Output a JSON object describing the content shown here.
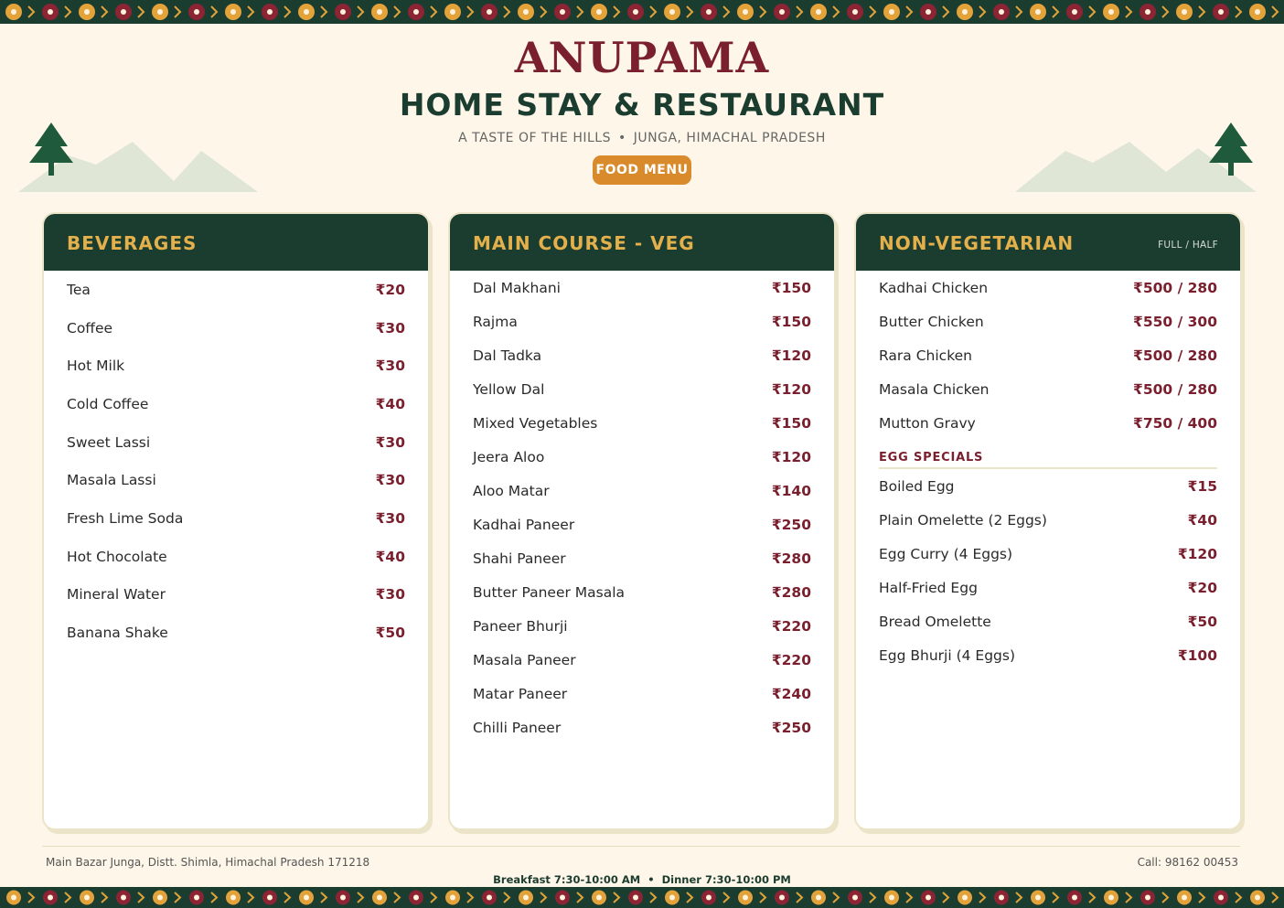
{
  "header": {
    "brand": "ANUPAMA",
    "subtitle": "HOME STAY & RESTAURANT",
    "tagline_left": "A TASTE OF THE HILLS",
    "tagline_sep": "•",
    "tagline_right": "JUNGA, HIMACHAL PRADESH",
    "badge": "FOOD MENU"
  },
  "colors": {
    "brand": "#7a1f2e",
    "green": "#1b3d2f",
    "gold": "#e3b04b",
    "orange": "#d98b2b",
    "cream": "#fdf6e9"
  },
  "beverages": {
    "title": "BEVERAGES",
    "items": [
      {
        "name": "Tea",
        "price": "₹20"
      },
      {
        "name": "Coffee",
        "price": "₹30"
      },
      {
        "name": "Hot Milk",
        "price": "₹30"
      },
      {
        "name": "Cold Coffee",
        "price": "₹40"
      },
      {
        "name": "Sweet Lassi",
        "price": "₹30"
      },
      {
        "name": "Masala Lassi",
        "price": "₹30"
      },
      {
        "name": "Fresh Lime Soda",
        "price": "₹30"
      },
      {
        "name": "Hot Chocolate",
        "price": "₹40"
      },
      {
        "name": "Mineral Water",
        "price": "₹30"
      },
      {
        "name": "Banana Shake",
        "price": "₹50"
      }
    ]
  },
  "veg": {
    "title": "MAIN COURSE - VEG",
    "items": [
      {
        "name": "Dal Makhani",
        "price": "₹150"
      },
      {
        "name": "Rajma",
        "price": "₹150"
      },
      {
        "name": "Dal Tadka",
        "price": "₹120"
      },
      {
        "name": "Yellow Dal",
        "price": "₹120"
      },
      {
        "name": "Mixed Vegetables",
        "price": "₹150"
      },
      {
        "name": "Jeera Aloo",
        "price": "₹120"
      },
      {
        "name": "Aloo Matar",
        "price": "₹140"
      },
      {
        "name": "Kadhai Paneer",
        "price": "₹250"
      },
      {
        "name": "Shahi Paneer",
        "price": "₹280"
      },
      {
        "name": "Butter Paneer Masala",
        "price": "₹280"
      },
      {
        "name": "Paneer Bhurji",
        "price": "₹220"
      },
      {
        "name": "Masala Paneer",
        "price": "₹220"
      },
      {
        "name": "Matar Paneer",
        "price": "₹240"
      },
      {
        "name": "Chilli Paneer",
        "price": "₹250"
      }
    ]
  },
  "nonveg": {
    "title": "NON-VEGETARIAN",
    "note": "FULL / HALF",
    "items": [
      {
        "name": "Kadhai Chicken",
        "price": "₹500 / 280"
      },
      {
        "name": "Butter Chicken",
        "price": "₹550 / 300"
      },
      {
        "name": "Rara Chicken",
        "price": "₹500 / 280"
      },
      {
        "name": "Masala Chicken",
        "price": "₹500 / 280"
      },
      {
        "name": "Mutton Gravy",
        "price": "₹750 / 400"
      }
    ],
    "egg_title": "EGG SPECIALS",
    "egg_items": [
      {
        "name": "Boiled Egg",
        "price": "₹15"
      },
      {
        "name": "Plain Omelette (2 Eggs)",
        "price": "₹40"
      },
      {
        "name": "Egg Curry (4 Eggs)",
        "price": "₹120"
      },
      {
        "name": "Half-Fried Egg",
        "price": "₹20"
      },
      {
        "name": "Bread Omelette",
        "price": "₹50"
      },
      {
        "name": "Egg Bhurji (4 Eggs)",
        "price": "₹100"
      }
    ]
  },
  "footer": {
    "address": "Main Bazar Junga, Distt. Shimla, Himachal Pradesh 171218",
    "phone": "Call: 98162 00453",
    "breakfast": "Breakfast 7:30-10:00 AM",
    "hours_sep": "•",
    "dinner": "Dinner 7:30-10:00 PM"
  }
}
